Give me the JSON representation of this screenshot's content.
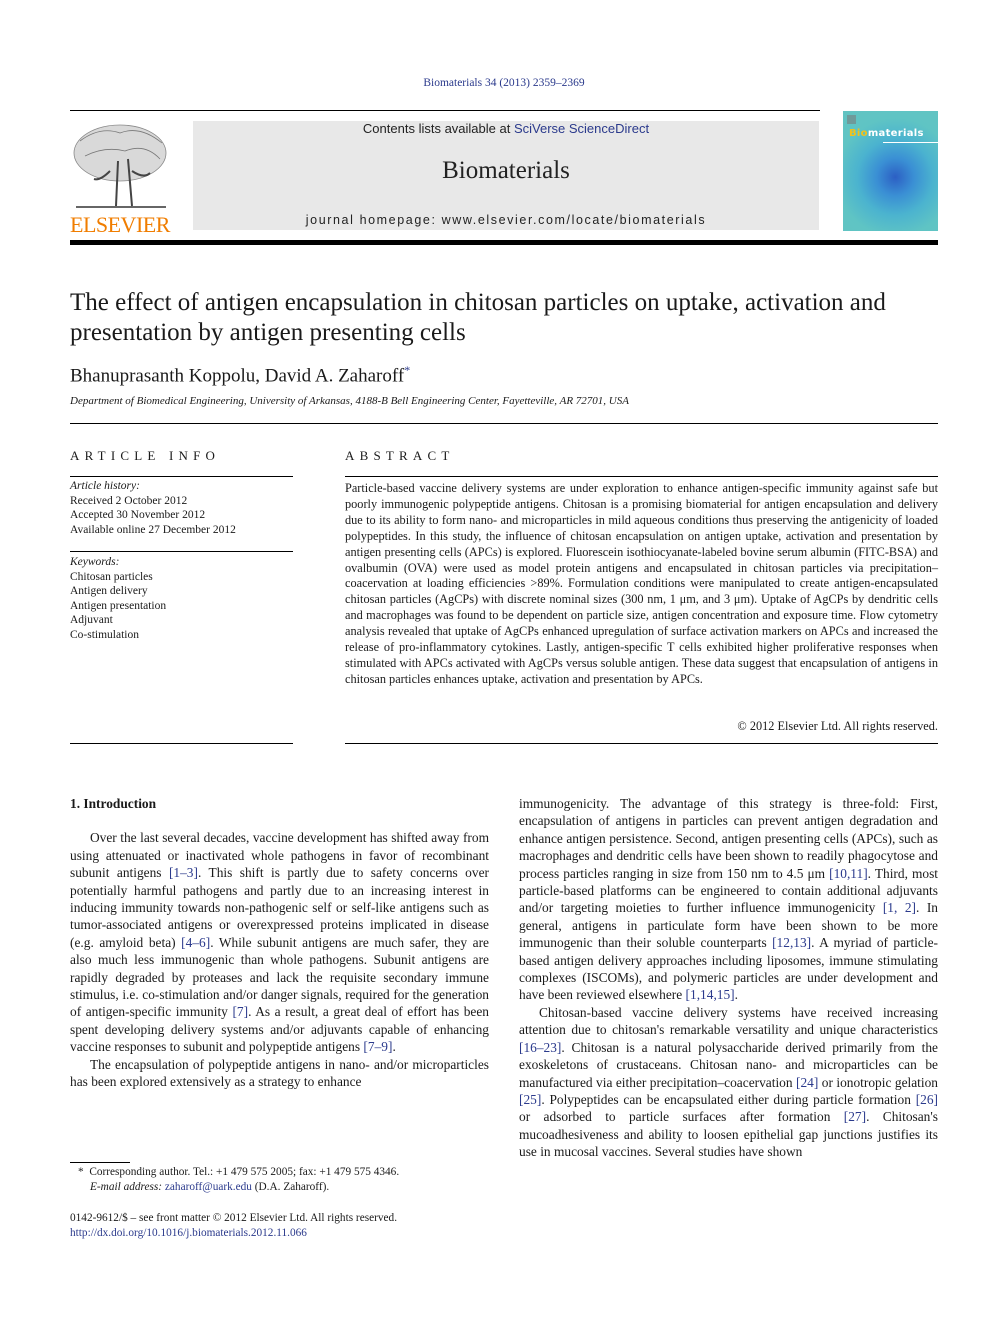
{
  "header": {
    "citation": "Biomaterials 34 (2013) 2359–2369",
    "contents_prefix": "Contents lists available at ",
    "contents_link": "SciVerse ScienceDirect",
    "journal_name": "Biomaterials",
    "homepage": "journal homepage: www.elsevier.com/locate/biomaterials",
    "publisher_logo_text": "ELSEVIER",
    "cover_title_accent": "Bio",
    "cover_title_rest": "materials",
    "colors": {
      "publisher_orange": "#f07d00",
      "link_blue": "#2b3a8c",
      "header_gray": "#e8e8e8"
    }
  },
  "article": {
    "title": "The effect of antigen encapsulation in chitosan particles on uptake, activation and presentation by antigen presenting cells",
    "authors": "Bhanuprasanth Koppolu, David A. Zaharoff",
    "author_mark": "*",
    "affiliation": "Department of Biomedical Engineering, University of Arkansas, 4188-B Bell Engineering Center, Fayetteville, AR 72701, USA"
  },
  "article_info": {
    "heading": "ARTICLE INFO",
    "history_label": "Article history:",
    "history": [
      "Received 2 October 2012",
      "Accepted 30 November 2012",
      "Available online 27 December 2012"
    ],
    "keywords_label": "Keywords:",
    "keywords": [
      "Chitosan particles",
      "Antigen delivery",
      "Antigen presentation",
      "Adjuvant",
      "Co-stimulation"
    ]
  },
  "abstract": {
    "heading": "ABSTRACT",
    "text": "Particle-based vaccine delivery systems are under exploration to enhance antigen-specific immunity against safe but poorly immunogenic polypeptide antigens. Chitosan is a promising biomaterial for antigen encapsulation and delivery due to its ability to form nano- and microparticles in mild aqueous conditions thus preserving the antigenicity of loaded polypeptides. In this study, the influence of chitosan encapsulation on antigen uptake, activation and presentation by antigen presenting cells (APCs) is explored. Fluorescein isothiocyanate-labeled bovine serum albumin (FITC-BSA) and ovalbumin (OVA) were used as model protein antigens and encapsulated in chitosan particles via precipitation–coacervation at loading efficiencies >89%. Formulation conditions were manipulated to create antigen-encapsulated chitosan particles (AgCPs) with discrete nominal sizes (300 nm, 1 μm, and 3 μm). Uptake of AgCPs by dendritic cells and macrophages was found to be dependent on particle size, antigen concentration and exposure time. Flow cytometry analysis revealed that uptake of AgCPs enhanced upregulation of surface activation markers on APCs and increased the release of pro-inflammatory cytokines. Lastly, antigen-specific T cells exhibited higher proliferative responses when stimulated with APCs activated with AgCPs versus soluble antigen. These data suggest that encapsulation of antigens in chitosan particles enhances uptake, activation and presentation by APCs.",
    "copyright": "© 2012 Elsevier Ltd. All rights reserved."
  },
  "introduction": {
    "heading": "1.  Introduction",
    "left_p1": [
      {
        "t": "Over the last several decades, vaccine development has shifted away from using attenuated or inactivated whole pathogens in favor of recombinant subunit antigens "
      },
      {
        "c": "[1–3]"
      },
      {
        "t": ". This shift is partly due to safety concerns over potentially harmful pathogens and partly due to an increasing interest in inducing immunity towards non-pathogenic self or self-like antigens such as tumor-associated antigens or overexpressed proteins implicated in disease (e.g. amyloid beta) "
      },
      {
        "c": "[4–6]"
      },
      {
        "t": ". While subunit antigens are much safer, they are also much less immunogenic than whole pathogens. Subunit antigens are rapidly degraded by proteases and lack the requisite secondary immune stimulus, i.e. co-stimulation and/or danger signals, required for the generation of antigen-specific immunity "
      },
      {
        "c": "[7]"
      },
      {
        "t": ". As a result, a great deal of effort has been spent developing delivery systems and/or adjuvants capable of enhancing vaccine responses to subunit and polypeptide antigens "
      },
      {
        "c": "[7–9]"
      },
      {
        "t": "."
      }
    ],
    "left_p2": [
      {
        "t": "The encapsulation of polypeptide antigens in nano- and/or microparticles has been explored extensively as a strategy to enhance"
      }
    ],
    "right_p1": [
      {
        "t": "immunogenicity. The advantage of this strategy is three-fold: First, encapsulation of antigens in particles can prevent antigen degradation and enhance antigen persistence. Second, antigen presenting cells (APCs), such as macrophages and dendritic cells have been shown to readily phagocytose and process particles ranging in size from 150 nm to 4.5 μm "
      },
      {
        "c": "[10,11]"
      },
      {
        "t": ". Third, most particle-based platforms can be engineered to contain additional adjuvants and/or targeting moieties to further influence immunogenicity "
      },
      {
        "c": "[1, 2]"
      },
      {
        "t": ". In general, antigens in particulate form have been shown to be more immunogenic than their soluble counterparts "
      },
      {
        "c": "[12,13]"
      },
      {
        "t": ". A myriad of particle-based antigen delivery approaches including liposomes, immune stimulating complexes (ISCOMs), and polymeric particles are under development and have been reviewed elsewhere "
      },
      {
        "c": "[1,14,15]"
      },
      {
        "t": "."
      }
    ],
    "right_p2": [
      {
        "t": "Chitosan-based vaccine delivery systems have received increasing attention due to chitosan's remarkable versatility and unique characteristics "
      },
      {
        "c": "[16–23]"
      },
      {
        "t": ". Chitosan is a natural polysaccharide derived primarily from the exoskeletons of crustaceans. Chitosan nano- and microparticles can be manufactured via either precipitation–coacervation "
      },
      {
        "c": "[24]"
      },
      {
        "t": " or ionotropic gelation "
      },
      {
        "c": "[25]"
      },
      {
        "t": ". Polypeptides can be encapsulated either during particle formation "
      },
      {
        "c": "[26]"
      },
      {
        "t": " or adsorbed to particle surfaces after formation "
      },
      {
        "c": "[27]"
      },
      {
        "t": ". Chitosan's mucoadhesiveness and ability to loosen epithelial gap junctions justifies its use in mucosal vaccines. Several studies have shown"
      }
    ]
  },
  "footnote": {
    "mark": "*",
    "corresponding": "Corresponding author. Tel.: +1 479 575 2005; fax: +1 479 575 4346.",
    "email_label": "E-mail address:",
    "email": "zaharoff@uark.edu",
    "email_suffix": " (D.A. Zaharoff)."
  },
  "footer": {
    "issn": "0142-9612/$ – see front matter © 2012 Elsevier Ltd. All rights reserved.",
    "doi": "http://dx.doi.org/10.1016/j.biomaterials.2012.11.066"
  }
}
